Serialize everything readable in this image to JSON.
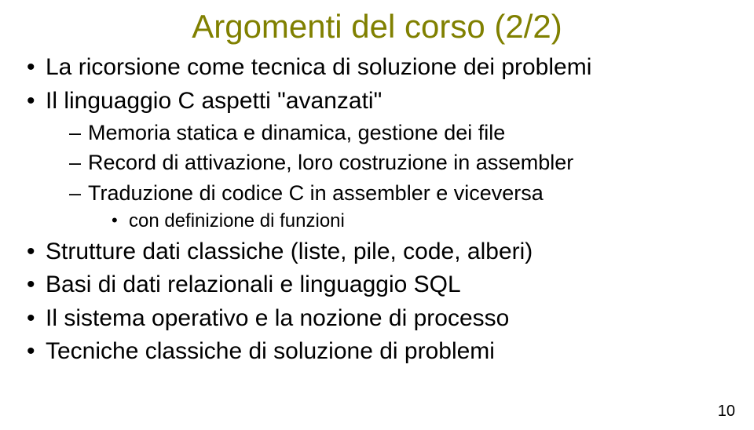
{
  "title": "Argomenti del corso (2/2)",
  "bullets": {
    "b1": "La ricorsione come tecnica di soluzione dei problemi",
    "b2": "Il linguaggio C aspetti \"avanzati\"",
    "b2s": {
      "s1": "Memoria statica e dinamica, gestione dei file",
      "s2": "Record di attivazione, loro costruzione in assembler",
      "s3": "Traduzione di codice C in assembler e viceversa",
      "s3s": {
        "ss1": "con definizione di funzioni"
      }
    },
    "b3": "Strutture dati classiche (liste, pile, code, alberi)",
    "b4": "Basi di dati relazionali e linguaggio SQL",
    "b5": "Il sistema operativo e la nozione di processo",
    "b6": "Tecniche classiche di soluzione di problemi"
  },
  "page_number": "10"
}
